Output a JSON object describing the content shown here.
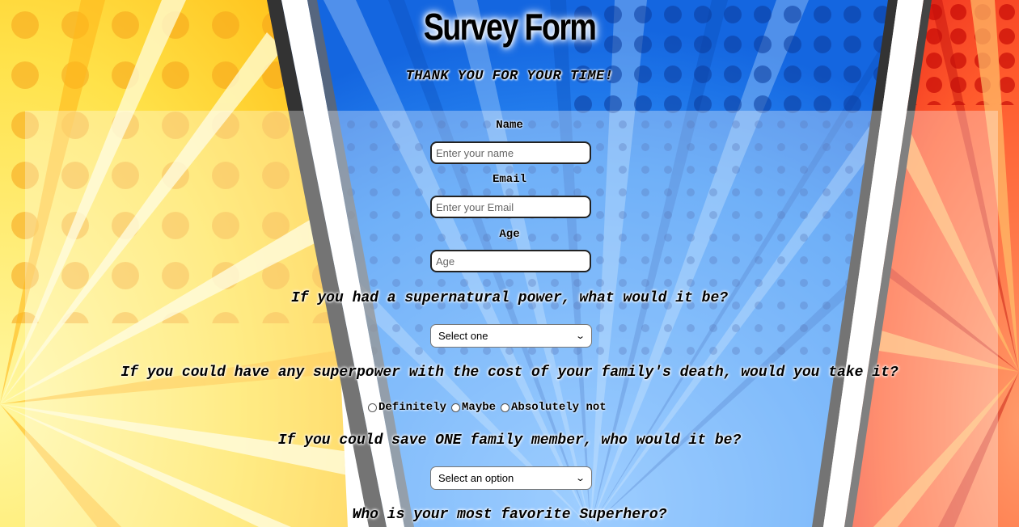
{
  "page": {
    "title": "Survey Form",
    "subtitle": "THANK YOU FOR YOUR TIME!"
  },
  "form": {
    "name": {
      "label": "Name",
      "placeholder": "Enter your name",
      "value": ""
    },
    "email": {
      "label": "Email",
      "placeholder": "Enter your Email",
      "value": ""
    },
    "age": {
      "label": "Age",
      "placeholder": "Age",
      "value": ""
    },
    "q_power": {
      "question": "If you had a supernatural power, what would it be?",
      "selected": "Select one"
    },
    "q_cost": {
      "question": "If you could have any superpower with the cost of your family's death, would you take it?",
      "options": [
        "Definitely",
        "Maybe",
        "Absolutely not"
      ]
    },
    "q_save": {
      "question": "If you could save ONE family member, who would it be?",
      "selected": "Select an option"
    },
    "q_hero": {
      "question": "Who is your most favorite Superhero?"
    }
  },
  "colors": {
    "left_panel": "#FFD21F",
    "center_panel": "#1E7BEF",
    "right_panel": "#F44528",
    "divider_white": "#FFFFFF",
    "divider_dark": "#555555"
  },
  "icons": {
    "select_chevron": "chevron-down-icon"
  }
}
